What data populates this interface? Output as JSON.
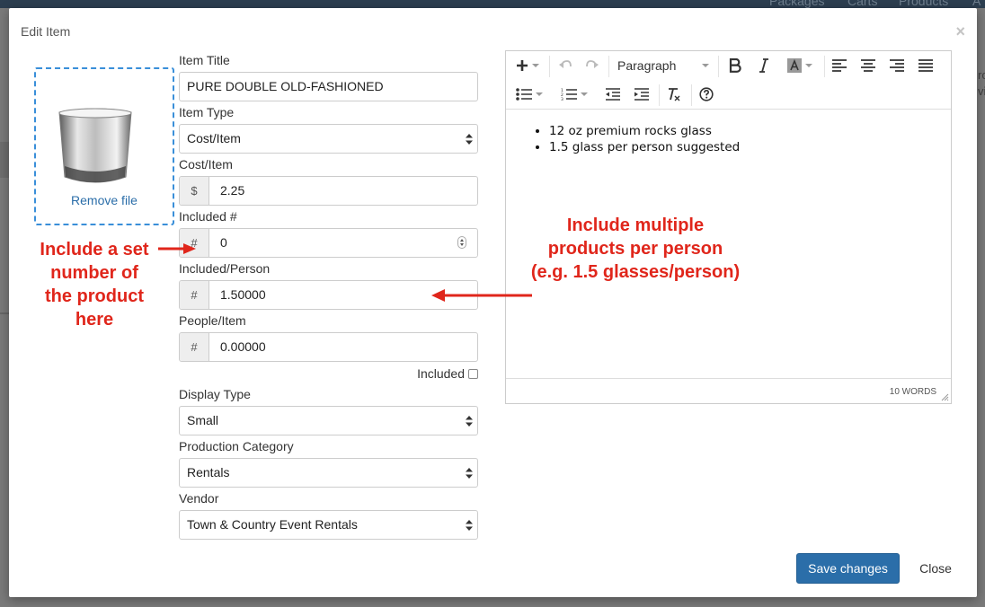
{
  "background": {
    "nav": [
      "Packages",
      "Carts",
      "Products",
      "A"
    ],
    "right_fragments": [
      "ro",
      "vi"
    ]
  },
  "modal": {
    "title": "Edit Item",
    "close_glyph": "×"
  },
  "image": {
    "remove_label": "Remove file"
  },
  "form": {
    "item_title_label": "Item Title",
    "item_title_value": "PURE DOUBLE OLD-FASHIONED",
    "item_type_label": "Item Type",
    "item_type_value": "Cost/Item",
    "cost_label": "Cost/Item",
    "cost_addon": "$",
    "cost_value": "2.25",
    "included_num_label": "Included #",
    "included_num_addon": "#",
    "included_num_value": "0",
    "included_person_label": "Included/Person",
    "included_person_addon": "#",
    "included_person_value": "1.50000",
    "people_item_label": "People/Item",
    "people_item_addon": "#",
    "people_item_value": "0.00000",
    "included_checkbox_label": "Included",
    "display_type_label": "Display Type",
    "display_type_value": "Small",
    "production_category_label": "Production Category",
    "production_category_value": "Rentals",
    "vendor_label": "Vendor",
    "vendor_value": "Town & Country Event Rentals"
  },
  "editor": {
    "block_format": "Paragraph",
    "bullets": [
      "12 oz premium rocks glass",
      "1.5 glass per person suggested"
    ],
    "word_count": "10 WORDS"
  },
  "footer": {
    "save_label": "Save changes",
    "close_label": "Close"
  },
  "annotations": {
    "left_lines": [
      "Include a set",
      "number of",
      "the product",
      "here"
    ],
    "right_lines": [
      "Include multiple",
      "products per person",
      "(e.g. 1.5 glasses/person)"
    ],
    "color": "#e0261b"
  },
  "colors": {
    "primary": "#2b6ea9",
    "dropzone_border": "#3a8fd9"
  }
}
